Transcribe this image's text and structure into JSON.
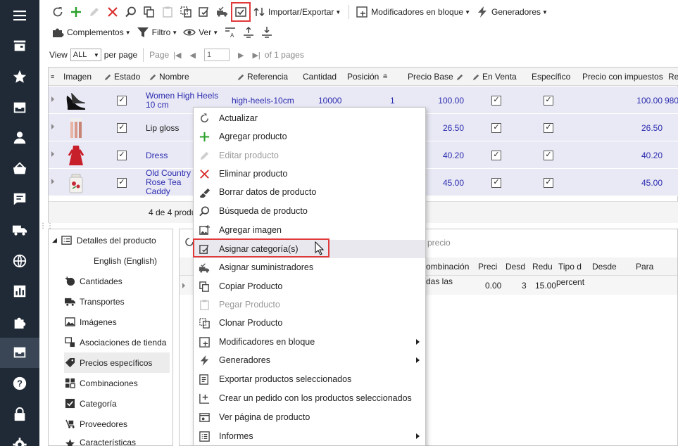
{
  "toolbar1": {
    "import_export": "Importar/Exportar",
    "bulk_modifiers": "Modificadores en bloque",
    "generators": "Generadores"
  },
  "toolbar2": {
    "addons": "Complementos",
    "filter": "Filtro",
    "view": "Ver"
  },
  "pager": {
    "view_label": "View",
    "per_page_value": "ALL",
    "per_page_label": "per page",
    "page_label": "Page",
    "page_value": "1",
    "of_pages": "of 1 pages"
  },
  "grid": {
    "columns": [
      "Imagen",
      "Estado",
      "Nombre",
      "Referencia",
      "Cantidad",
      "Posición",
      "Precio Base",
      "En Venta",
      "Específico",
      "Precio con impuestos",
      "Re"
    ],
    "rows": [
      {
        "name": "Women High Heels 10 cm",
        "reference": "high-heels-10cm",
        "quantity": "10000",
        "position": "1",
        "base_price": "100.00",
        "price_tax": "100.00",
        "extra": "980"
      },
      {
        "name": "Lip gloss",
        "reference": "",
        "quantity": "",
        "position": "",
        "base_price": "26.50",
        "price_tax": "26.50",
        "extra": ""
      },
      {
        "name": "Dress",
        "reference": "",
        "quantity": "",
        "position": "",
        "base_price": "40.20",
        "price_tax": "40.20",
        "extra": ""
      },
      {
        "name": "Old Country Rose Tea Caddy",
        "reference": "",
        "quantity": "",
        "position": "",
        "base_price": "45.00",
        "price_tax": "45.00",
        "extra": ""
      }
    ],
    "footer": "4 de 4 produ"
  },
  "tree": {
    "items": [
      "Detalles del producto",
      "English (English)",
      "Cantidades",
      "Transportes",
      "Imágenes",
      "Asociaciones de tienda",
      "Precios específicos",
      "Combinaciones",
      "Categoría",
      "Proveedores",
      "Características"
    ]
  },
  "lower_right": {
    "action_text": "ar precio",
    "columns": [
      "ombinación",
      "Preci",
      "Desd",
      "Redu",
      "Tipo d",
      "Desde",
      "Para"
    ],
    "row": {
      "combination": "das las",
      "price": "0.00",
      "from": "3",
      "reduction": "15.00",
      "type": "percent"
    }
  },
  "context_menu": {
    "items": [
      {
        "label": "Actualizar",
        "icon": "refresh-icon",
        "disabled": false,
        "submenu": false
      },
      {
        "label": "Agregar producto",
        "icon": "plus-icon",
        "disabled": false,
        "submenu": false
      },
      {
        "label": "Editar producto",
        "icon": "pencil-icon",
        "disabled": true,
        "submenu": false
      },
      {
        "label": "Eliminar producto",
        "icon": "delete-x-icon",
        "disabled": false,
        "submenu": false
      },
      {
        "label": "Borrar datos de producto",
        "icon": "eraser-icon",
        "disabled": false,
        "submenu": false
      },
      {
        "label": "Búsqueda de producto",
        "icon": "search-icon",
        "disabled": false,
        "submenu": false
      },
      {
        "label": "Agregar imagen",
        "icon": "add-image-icon",
        "disabled": false,
        "submenu": false
      },
      {
        "label": "Asignar categoría(s)",
        "icon": "assign-category-icon",
        "disabled": false,
        "submenu": false
      },
      {
        "label": "Asignar suministradores",
        "icon": "truck-check-icon",
        "disabled": false,
        "submenu": false
      },
      {
        "label": "Copiar Producto",
        "icon": "copy-icon",
        "disabled": false,
        "submenu": false
      },
      {
        "label": "Pegar Producto",
        "icon": "paste-icon",
        "disabled": true,
        "submenu": false
      },
      {
        "label": "Clonar Producto",
        "icon": "clone-icon",
        "disabled": false,
        "submenu": false
      },
      {
        "label": "Modificadores en bloque",
        "icon": "bulk-modify-icon",
        "disabled": false,
        "submenu": true
      },
      {
        "label": "Generadores",
        "icon": "lightning-icon",
        "disabled": false,
        "submenu": true
      },
      {
        "label": "Exportar productos seleccionados",
        "icon": "export-icon",
        "disabled": false,
        "submenu": false
      },
      {
        "label": "Crear un pedido con los productos seleccionados",
        "icon": "create-order-icon",
        "disabled": false,
        "submenu": false
      },
      {
        "label": "Ver página de producto",
        "icon": "view-page-icon",
        "disabled": false,
        "submenu": false
      },
      {
        "label": "Informes",
        "icon": "report-icon",
        "disabled": false,
        "submenu": true
      }
    ]
  },
  "colors": {
    "sidebar_bg": "#1f2a36",
    "link_blue": "#2b2bb0",
    "highlight_red": "#e03a3a",
    "row_bg": "#e9e9f5",
    "add_green": "#2aa02a",
    "delete_red": "#d9302e"
  }
}
